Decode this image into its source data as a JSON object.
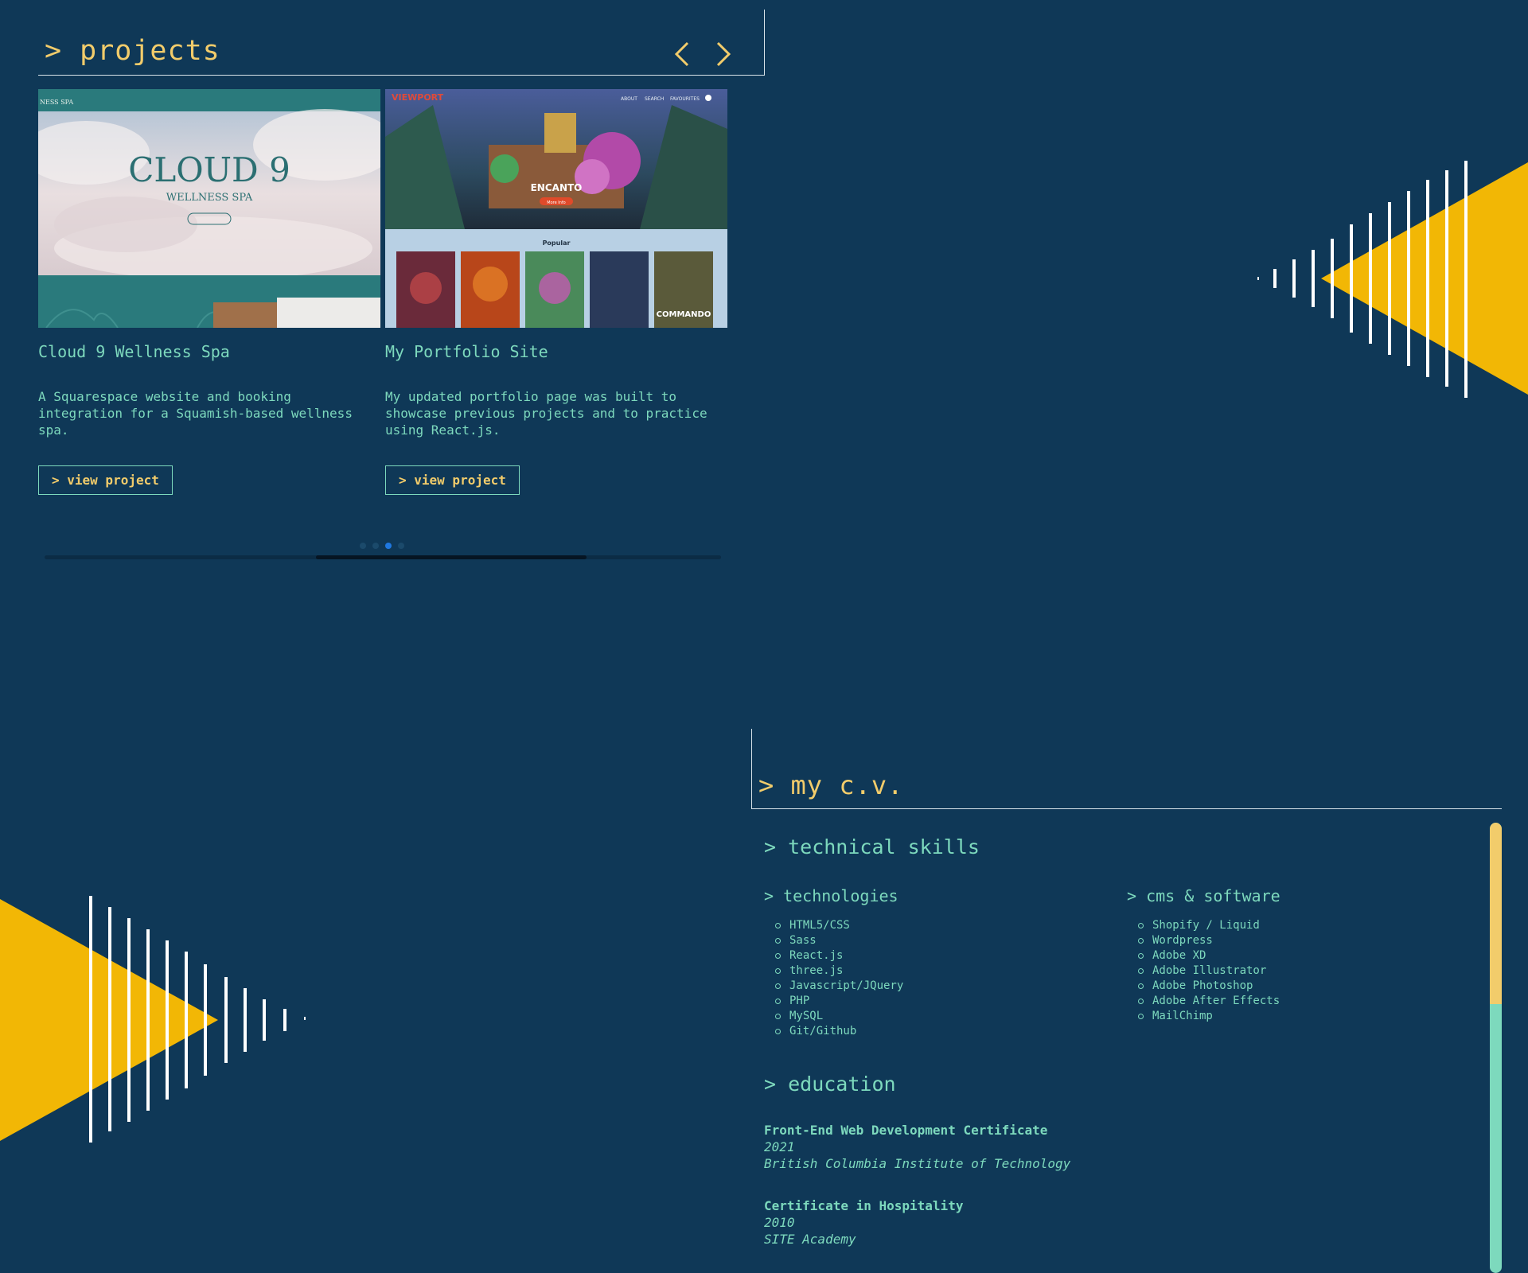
{
  "projects": {
    "title": "> projects",
    "prev_label": "previous",
    "next_label": "next",
    "cards": [
      {
        "title": "Cloud 9 Wellness Spa",
        "description": "A Squarespace website and booking integration for a Squamish-based wellness spa.",
        "button": "> view project",
        "thumb": {
          "nav": "NESS SPA",
          "headline": "CLOUD 9",
          "sub": "WELLNESS SPA"
        }
      },
      {
        "title": "My Portfolio Site",
        "description": "My updated portfolio page was built to showcase previous projects and to practice using React.js.",
        "button": "> view project",
        "thumb": {
          "logo": "VIEWPORT",
          "nav": [
            "ABOUT",
            "SEARCH",
            "FAVOURITES"
          ],
          "hero": "ENCANTO",
          "hero_button": "More Info",
          "section": "Popular",
          "poster_label": "COMMANDO"
        }
      }
    ],
    "carousel": {
      "dots": 4,
      "active_index": 2
    }
  },
  "cv": {
    "title": "> my c.v.",
    "skills_heading": "> technical skills",
    "technologies_heading": "> technologies",
    "technologies": [
      "HTML5/CSS",
      "Sass",
      "React.js",
      "three.js",
      "Javascript/JQuery",
      "PHP",
      "MySQL",
      "Git/Github"
    ],
    "cms_heading": "> cms & software",
    "cms": [
      "Shopify / Liquid",
      "Wordpress",
      "Adobe XD",
      "Adobe Illustrator",
      "Adobe Photoshop",
      "Adobe After Effects",
      "MailChimp"
    ],
    "education_heading": "> education",
    "education": [
      {
        "title": "Front-End Web Development Certificate",
        "year": "2021",
        "school": "British Columbia Institute of Technology"
      },
      {
        "title": "Certificate in Hospitality",
        "year": "2010",
        "school": "SITE Academy"
      }
    ]
  },
  "colors": {
    "background": "#0f3857",
    "accent_yellow": "#f2cc6b",
    "accent_teal": "#7dd9bd",
    "triangle": "#f2b705",
    "active_dot": "#1f78e0"
  }
}
